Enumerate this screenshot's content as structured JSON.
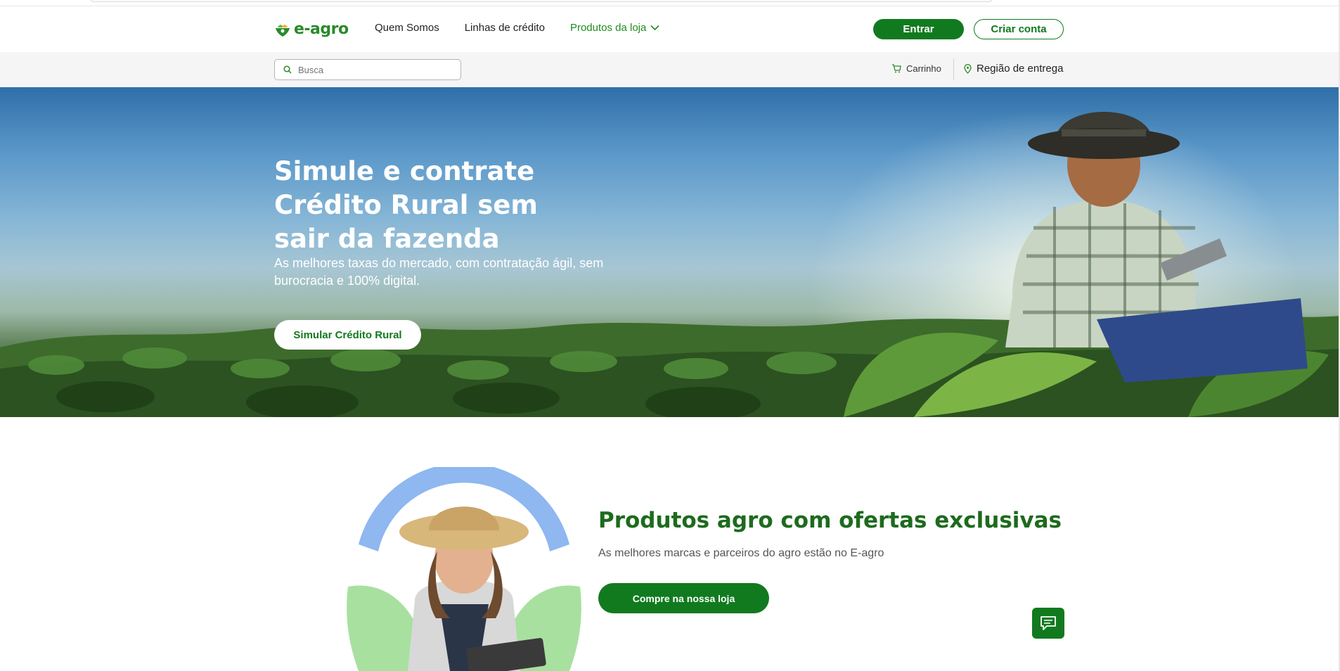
{
  "brand": {
    "name": "e-agro",
    "primary_color": "#117a1f",
    "accent_color": "#2a8a2a"
  },
  "nav": {
    "links": [
      {
        "label": "Quem Somos"
      },
      {
        "label": "Linhas de crédito"
      },
      {
        "label": "Produtos da loja"
      }
    ],
    "login_label": "Entrar",
    "signup_label": "Criar conta"
  },
  "subbar": {
    "search_placeholder": "Busca",
    "cart_label": "Carrinho",
    "region_label": "Região de entrega"
  },
  "hero": {
    "title": "Simule e contrate Crédito Rural sem sair da fazenda",
    "subtitle": "As melhores taxas do mercado, com contratação ágil, sem burocracia e 100% digital.",
    "cta_label": "Simular Crédito Rural"
  },
  "promo": {
    "title": "Produtos agro com ofertas exclusivas",
    "subtitle": "As melhores marcas e parceiros do agro estão no E-agro",
    "cta_label": "Compre na nossa loja"
  },
  "icons": {
    "search": "search-icon",
    "cart": "cart-icon",
    "location": "location-pin-icon",
    "chevron": "chevron-down-icon",
    "chat": "chat-icon"
  }
}
